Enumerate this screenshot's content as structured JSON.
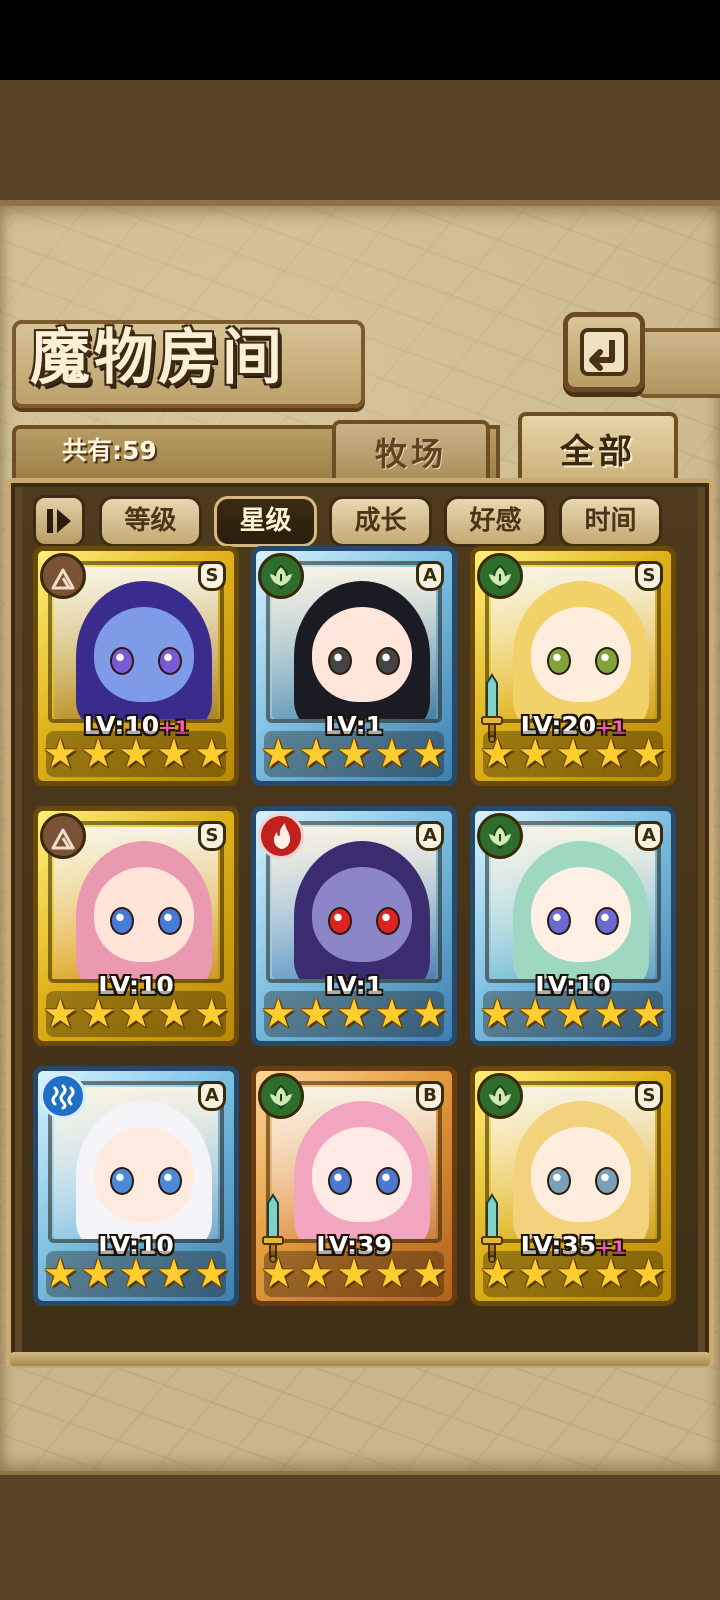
{
  "title": "魔物房间",
  "back_icon": "return-arrow-icon",
  "count_label": "共有:59",
  "tabs": [
    {
      "label": "牧场",
      "active": false
    },
    {
      "label": "全部",
      "active": true
    }
  ],
  "sort": {
    "toggle_icon": "sort-direction-icon",
    "options": [
      {
        "label": "等级",
        "active": false
      },
      {
        "label": "星级",
        "active": true
      },
      {
        "label": "成长",
        "active": false
      },
      {
        "label": "好感",
        "active": false
      },
      {
        "label": "时间",
        "active": false
      }
    ]
  },
  "monsters": [
    {
      "element": "earth",
      "rank": "S",
      "frame": "gold",
      "level": "LV:10",
      "plus": "+1",
      "stars": 5,
      "weapon": false,
      "hair": "#3a2c8c",
      "skin": "#7f9be8",
      "eye": "#7a5ad6"
    },
    {
      "element": "wood",
      "rank": "A",
      "frame": "blue",
      "level": "LV:1",
      "plus": "",
      "stars": 5,
      "weapon": false,
      "hair": "#1b1b24",
      "skin": "#ffe6da",
      "eye": "#444"
    },
    {
      "element": "wood",
      "rank": "S",
      "frame": "gold",
      "level": "LV:20",
      "plus": "+1",
      "stars": 5,
      "weapon": true,
      "hair": "#f1d16a",
      "skin": "#ffeede",
      "eye": "#7ea43a"
    },
    {
      "element": "earth",
      "rank": "S",
      "frame": "gold",
      "level": "LV:10",
      "plus": "",
      "stars": 5,
      "weapon": false,
      "hair": "#e99ab0",
      "skin": "#ffe4d8",
      "eye": "#4a7ad8"
    },
    {
      "element": "fire",
      "rank": "A",
      "frame": "blue",
      "level": "LV:1",
      "plus": "",
      "stars": 5,
      "weapon": false,
      "hair": "#3a2c6e",
      "skin": "#8c86c8",
      "eye": "#d22"
    },
    {
      "element": "wood",
      "rank": "A",
      "frame": "blue",
      "level": "LV:10",
      "plus": "",
      "stars": 5,
      "weapon": false,
      "hair": "#9fd8c0",
      "skin": "#fff0e6",
      "eye": "#6a6ad0"
    },
    {
      "element": "water",
      "rank": "A",
      "frame": "blue",
      "level": "LV:10",
      "plus": "",
      "stars": 5,
      "weapon": false,
      "hair": "#f4f4f8",
      "skin": "#ffeae0",
      "eye": "#4a8ad8"
    },
    {
      "element": "wood",
      "rank": "B",
      "frame": "bronze",
      "level": "LV:39",
      "plus": "",
      "stars": 5,
      "weapon": true,
      "hair": "#f2a5be",
      "skin": "#ffeae6",
      "eye": "#4a7ad0"
    },
    {
      "element": "wood",
      "rank": "S",
      "frame": "gold",
      "level": "LV:35",
      "plus": "+1",
      "stars": 5,
      "weapon": true,
      "hair": "#f3d27e",
      "skin": "#ffeede",
      "eye": "#7aa0b8"
    }
  ]
}
